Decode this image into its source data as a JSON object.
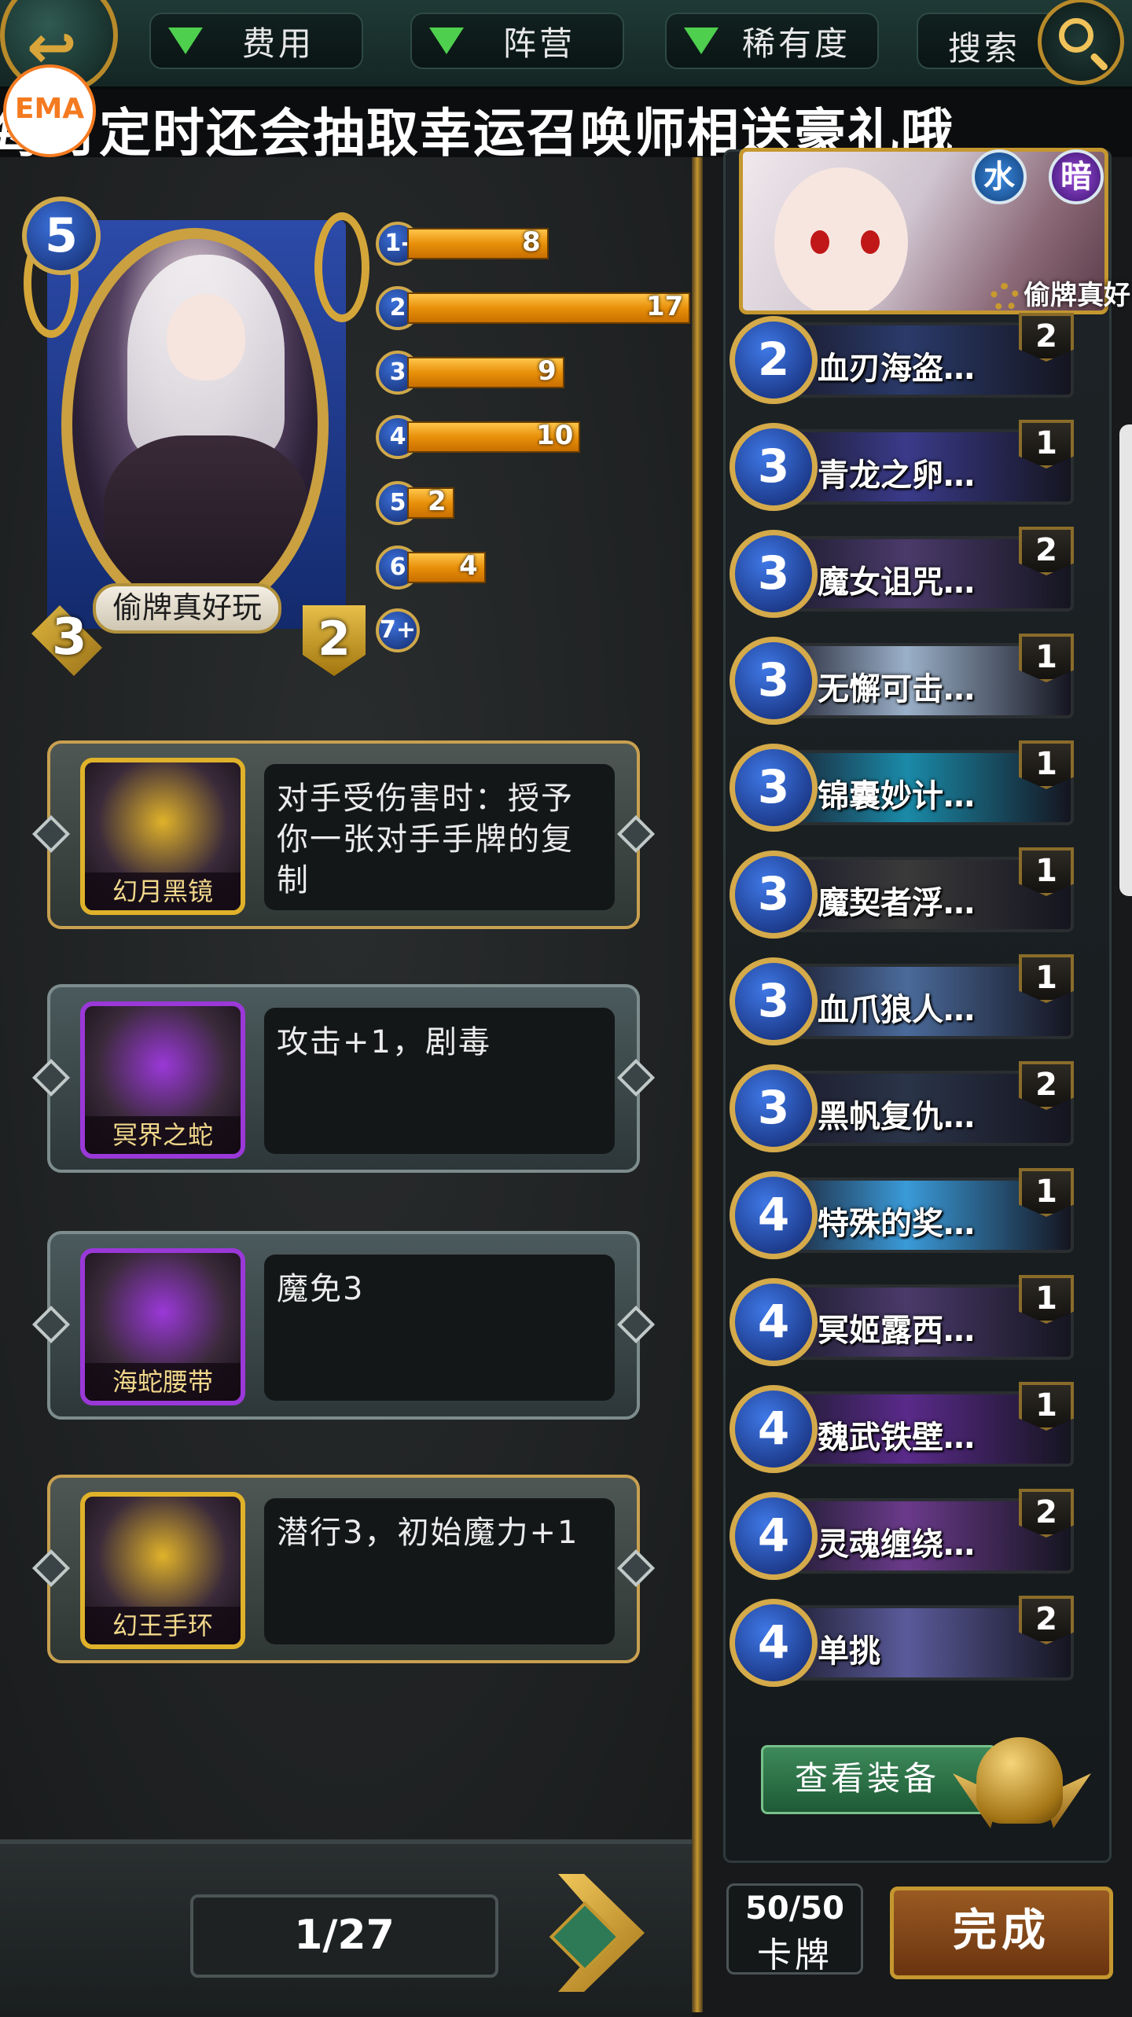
{
  "top_bar": {
    "filters": [
      {
        "label": "费用"
      },
      {
        "label": "阵营"
      },
      {
        "label": "稀有度"
      }
    ],
    "search_label": "搜索"
  },
  "marquee": {
    "text": "每月定时还会抽取幸运召唤师相送豪礼哦",
    "logo_text": "EMA"
  },
  "hero": {
    "cost": "5",
    "name": "偷牌真好玩",
    "attack": "3",
    "health": "2"
  },
  "mana_curve": [
    {
      "cost": "1-",
      "count": 8
    },
    {
      "cost": "2",
      "count": 17
    },
    {
      "cost": "3",
      "count": 9
    },
    {
      "cost": "4",
      "count": 10
    },
    {
      "cost": "5",
      "count": 2
    },
    {
      "cost": "6",
      "count": 4
    },
    {
      "cost": "7+",
      "count": 0
    }
  ],
  "equipment": [
    {
      "name": "幻月黑镜",
      "desc": "对手受伤害时：授予你一张对手手牌的复制",
      "frame": "gold",
      "color": "#e0b22a"
    },
    {
      "name": "冥界之蛇",
      "desc": "攻击+1，剧毒",
      "frame": "silver",
      "color": "#9a38d8"
    },
    {
      "name": "海蛇腰带",
      "desc": "魔免3",
      "frame": "silver",
      "color": "#9a38d8"
    },
    {
      "name": "幻王手环",
      "desc": "潜行3，初始魔力+1",
      "frame": "gold",
      "color": "#e0b22a"
    }
  ],
  "deck": {
    "hero_name": "偷牌真好",
    "elements": [
      "水",
      "暗"
    ],
    "cards": [
      {
        "cost": "2",
        "name": "血刃海盗…",
        "qty": "2",
        "color": "#2a3a6a"
      },
      {
        "cost": "3",
        "name": "青龙之卵…",
        "qty": "1",
        "color": "#3a3a8a"
      },
      {
        "cost": "3",
        "name": "魔女诅咒…",
        "qty": "2",
        "color": "#4a3a6a"
      },
      {
        "cost": "3",
        "name": "无懈可击…",
        "qty": "1",
        "color": "#9ab0c8"
      },
      {
        "cost": "3",
        "name": "锦囊妙计…",
        "qty": "1",
        "color": "#1a8aa8"
      },
      {
        "cost": "3",
        "name": "魔契者浮…",
        "qty": "1",
        "color": "#3a3a3a"
      },
      {
        "cost": "3",
        "name": "血爪狼人…",
        "qty": "1",
        "color": "#4a6a9a"
      },
      {
        "cost": "3",
        "name": "黑帆复仇…",
        "qty": "2",
        "color": "#2a3448"
      },
      {
        "cost": "4",
        "name": "特殊的奖…",
        "qty": "1",
        "color": "#3a9ad8"
      },
      {
        "cost": "4",
        "name": "冥姬露西…",
        "qty": "1",
        "color": "#4a3a6a"
      },
      {
        "cost": "4",
        "name": "魏武铁壁…",
        "qty": "1",
        "color": "#5a2a8a"
      },
      {
        "cost": "4",
        "name": "灵魂缠绕…",
        "qty": "2",
        "color": "#6a3a8a"
      },
      {
        "cost": "4",
        "name": "单挑",
        "qty": "2",
        "color": "#5a5a9a"
      }
    ],
    "view_equipment_label": "查看装备"
  },
  "bottom": {
    "page": "1/27",
    "card_count": "50/50",
    "card_count_label": "卡牌",
    "done_label": "完成"
  }
}
